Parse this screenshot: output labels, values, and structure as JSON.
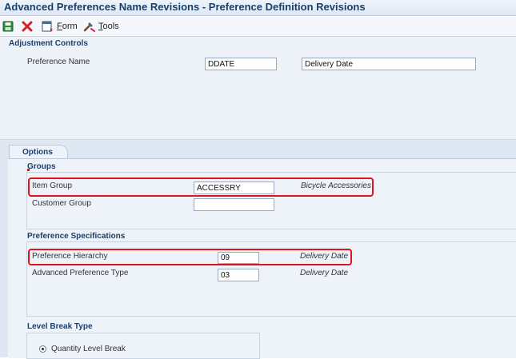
{
  "window": {
    "title": "Advanced Preferences Name Revisions - Preference Definition Revisions"
  },
  "toolbar": {
    "save_icon": "save-icon",
    "close_icon": "close-icon",
    "form_label": "Form",
    "tools_label": "Tools"
  },
  "adjustment_controls": {
    "heading": "Adjustment Controls",
    "preference_name_label": "Preference Name",
    "preference_name_value": "DDATE",
    "preference_description": "Delivery Date"
  },
  "tabs": [
    {
      "label": "Options",
      "selected": true
    }
  ],
  "groups": {
    "heading": "Groups",
    "item_group_label": "Item Group",
    "item_group_value": "ACCESSRY",
    "item_group_desc": "Bicycle Accessories",
    "customer_group_label": "Customer Group",
    "customer_group_value": ""
  },
  "preference_specs": {
    "heading": "Preference Specifications",
    "hierarchy_label": "Preference Hierarchy",
    "hierarchy_value": "09",
    "hierarchy_desc": "Delivery Date",
    "type_label": "Advanced Preference Type",
    "type_value": "03",
    "type_desc": "Delivery Date"
  },
  "level_break": {
    "heading": "Level Break Type",
    "option_label": "Quantity Level Break",
    "selected": true
  },
  "colors": {
    "highlight": "#e0141e",
    "heading": "#1b3f6b"
  }
}
